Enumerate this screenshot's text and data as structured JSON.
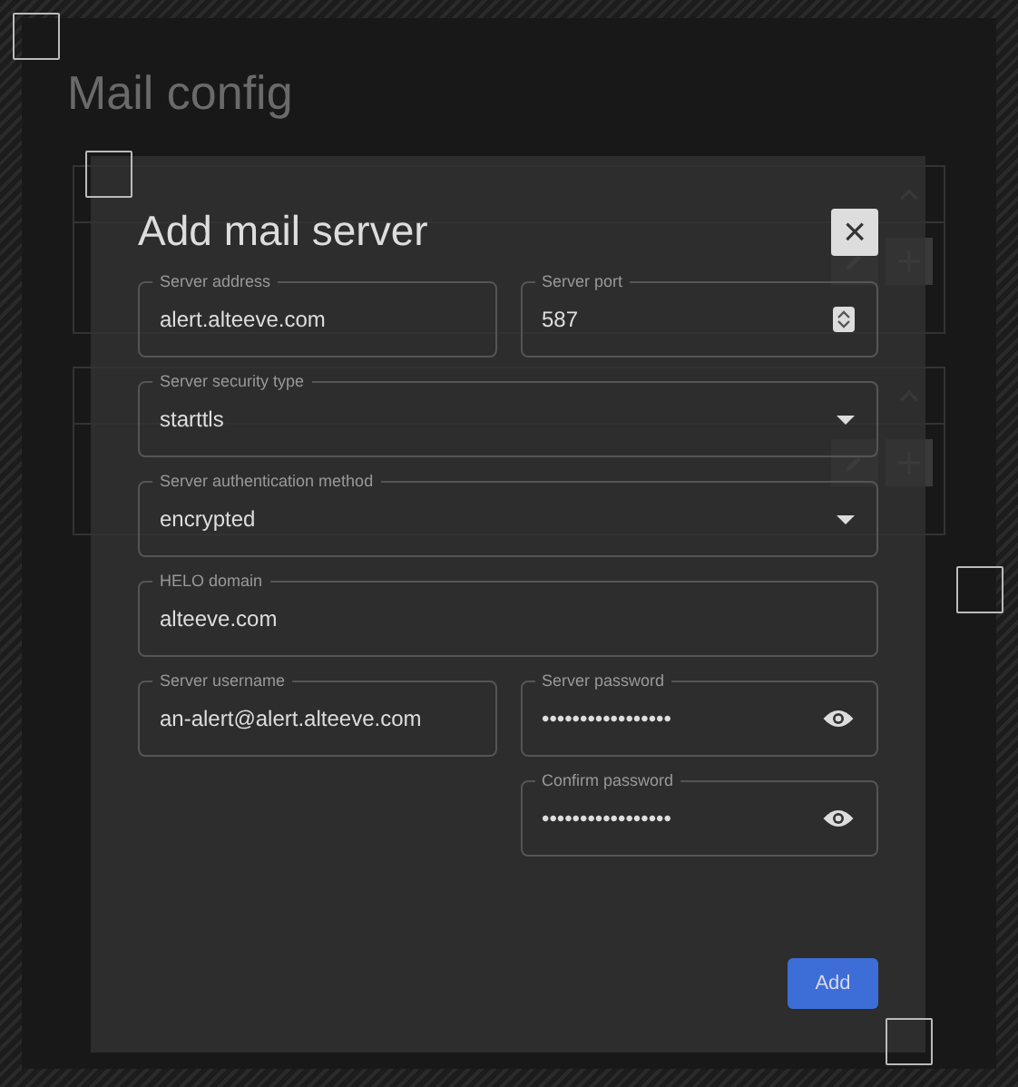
{
  "page": {
    "title": "Mail config"
  },
  "dialog": {
    "title": "Add mail server",
    "close": "×",
    "rows": [
      [
        {
          "kind": "text",
          "label": "Server address",
          "value": "alert.alteeve.com"
        },
        {
          "kind": "number",
          "label": "Server port",
          "value": "587"
        }
      ],
      [
        {
          "kind": "select",
          "label": "Server security type",
          "value": "starttls"
        }
      ],
      [
        {
          "kind": "select",
          "label": "Server authentication method",
          "value": "encrypted"
        }
      ],
      [
        {
          "kind": "text",
          "label": "HELO domain",
          "value": "alteeve.com"
        }
      ],
      [
        {
          "kind": "text",
          "label": "Server username",
          "value": "an-alert@alert.alteeve.com"
        },
        {
          "kind": "password",
          "label": "Server password",
          "value": "•••••••••••••••••"
        }
      ],
      [
        {
          "kind": "blank"
        },
        {
          "kind": "password",
          "label": "Confirm password",
          "value": "•••••••••••••••••"
        }
      ]
    ],
    "submit": "Add"
  }
}
